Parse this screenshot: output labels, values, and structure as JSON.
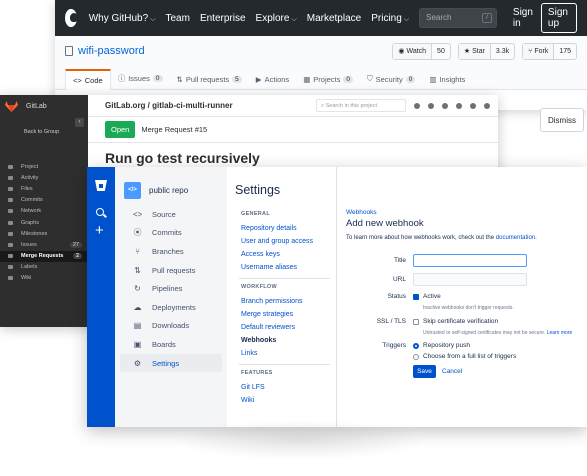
{
  "github": {
    "nav": [
      "Why GitHub?",
      "Team",
      "Enterprise",
      "Explore",
      "Marketplace",
      "Pricing"
    ],
    "search_placeholder": "Search",
    "search_key": "/",
    "sign_in": "Sign in",
    "sign_up": "Sign up",
    "repo_name": "wifi-password",
    "watch_label": "Watch",
    "watch_count": "50",
    "star_label": "Star",
    "star_count": "3.3k",
    "fork_label": "Fork",
    "fork_count": "175",
    "tabs": [
      {
        "label": "Code"
      },
      {
        "label": "Issues",
        "count": "0"
      },
      {
        "label": "Pull requests",
        "count": "5"
      },
      {
        "label": "Actions"
      },
      {
        "label": "Projects",
        "count": "0"
      },
      {
        "label": "Security",
        "count": "0"
      },
      {
        "label": "Insights"
      }
    ],
    "dismiss": "Dismiss"
  },
  "gitlab": {
    "brand": "GitLab",
    "back": "Back to Group",
    "nav": [
      {
        "label": "Project"
      },
      {
        "label": "Activity"
      },
      {
        "label": "Files"
      },
      {
        "label": "Commits"
      },
      {
        "label": "Network"
      },
      {
        "label": "Graphs"
      },
      {
        "label": "Milestones"
      },
      {
        "label": "Issues",
        "badge": "27"
      },
      {
        "label": "Merge Requests",
        "badge": "2"
      },
      {
        "label": "Labels"
      },
      {
        "label": "Wiki"
      }
    ],
    "breadcrumb": "GitLab.org / gitlab-ci-multi-runner",
    "search_placeholder": "Search in this project",
    "status": "Open",
    "mr_label": "Merge Request #15",
    "mr_title": "Run go test recursively"
  },
  "bitbucket": {
    "repo_name": "public repo",
    "nav": [
      "Source",
      "Commits",
      "Branches",
      "Pull requests",
      "Pipelines",
      "Deployments",
      "Downloads",
      "Boards",
      "Settings"
    ],
    "settings_title": "Settings",
    "sections": {
      "general": "GENERAL",
      "workflow": "WORKFLOW",
      "features": "FEATURES"
    },
    "general_links": [
      "Repository details",
      "User and group access",
      "Access keys",
      "Username aliases"
    ],
    "workflow_links": [
      "Branch permissions",
      "Merge strategies",
      "Default reviewers",
      "Webhooks",
      "Links"
    ],
    "feature_links": [
      "Git LFS",
      "Wiki"
    ],
    "form": {
      "breadcrumb": "Webhooks",
      "title": "Add new webhook",
      "intro": "To learn more about how webhooks work, check out the",
      "intro_link": "documentation",
      "intro_end": ".",
      "title_label": "Title",
      "url_label": "URL",
      "status_label": "Status",
      "active_option": "Active",
      "active_help": "Inactive webhooks don't trigger requests.",
      "ssl_label": "SSL / TLS",
      "ssl_option": "Skip certificate verification",
      "ssl_help": "Untrusted or self-signed certificates may not be secure.",
      "ssl_help_link": "Learn more",
      "triggers_label": "Triggers",
      "trigger_push": "Repository push",
      "trigger_full": "Choose from a full list of triggers",
      "save": "Save",
      "cancel": "Cancel"
    }
  }
}
